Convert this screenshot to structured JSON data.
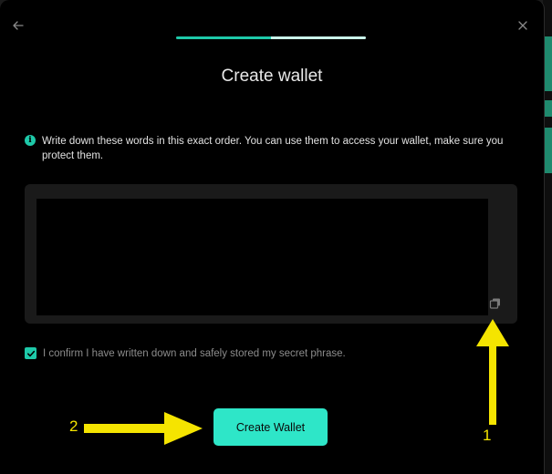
{
  "modal": {
    "title": "Create wallet",
    "progress_step": 1,
    "progress_total": 2,
    "info_text": "Write down these words in this exact order. You can use them to access your wallet, make sure you protect them.",
    "confirm_checked": true,
    "confirm_label": "I confirm I have written down and safely stored my secret phrase.",
    "create_button_label": "Create Wallet"
  },
  "icons": {
    "back": "arrow-left-icon",
    "close": "close-icon",
    "info": "info-icon",
    "copy": "copy-icon",
    "check": "checkmark-icon"
  },
  "colors": {
    "accent": "#2ee6c8",
    "annotation": "#f5e400"
  },
  "annotations": {
    "label_1": "1",
    "label_2": "2"
  }
}
